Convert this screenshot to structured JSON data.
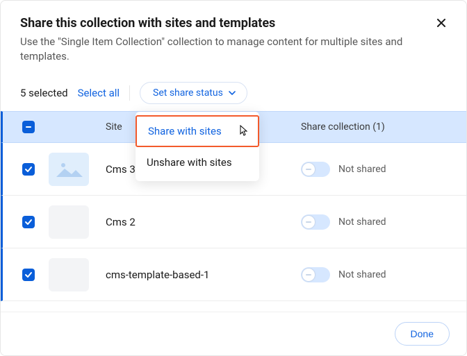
{
  "header": {
    "title": "Share this collection with sites and templates",
    "subtitle": "Use the \"Single Item Collection\" collection to manage content for multiple sites and templates."
  },
  "controls": {
    "selected_count": "5 selected",
    "select_all": "Select all",
    "set_share_label": "Set share status"
  },
  "columns": {
    "site": "Site",
    "share": "Share collection (1)"
  },
  "dropdown": {
    "share": "Share with sites",
    "unshare": "Unshare with sites"
  },
  "rows": [
    {
      "name": "Cms 3",
      "status": "Not shared"
    },
    {
      "name": "Cms 2",
      "status": "Not shared"
    },
    {
      "name": "cms-template-based-1",
      "status": "Not shared"
    }
  ],
  "footer": {
    "done": "Done"
  }
}
